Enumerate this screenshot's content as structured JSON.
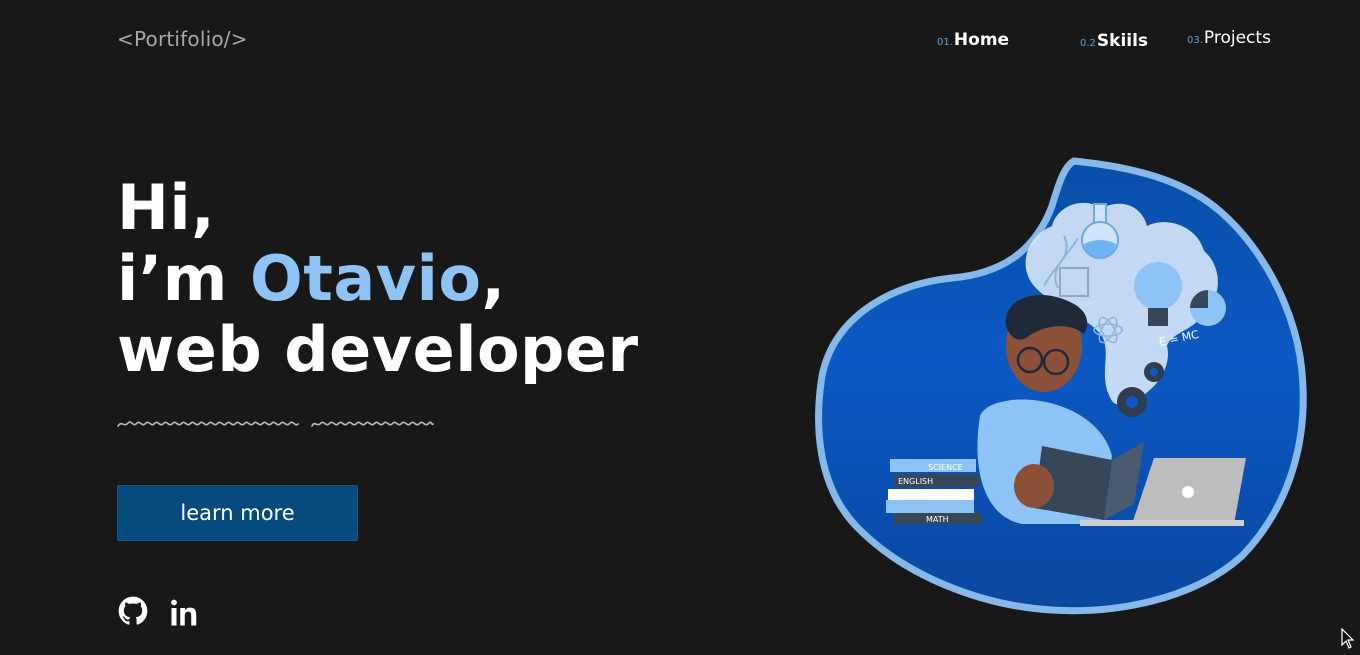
{
  "header": {
    "logo": "<Portifolio/>",
    "nav": [
      {
        "num": "01.",
        "label": "Home"
      },
      {
        "num": "0.2",
        "label": "Skiils"
      },
      {
        "num": "03.",
        "label": "Projects"
      }
    ]
  },
  "hero": {
    "line1": "Hi,",
    "line2_prefix": "i’m ",
    "name": "Otavio",
    "line2_suffix": ",",
    "line3": "web developer",
    "button_label": "learn more"
  },
  "illustration": {
    "book_labels": [
      "SCIENCE",
      "ENGLISH",
      "MATH"
    ],
    "formula": "E = MC"
  },
  "social": {
    "icons": [
      "github-icon",
      "linkedin-icon"
    ]
  },
  "colors": {
    "background": "#181818",
    "accent": "#8ec3f5",
    "button": "#064a7e",
    "nav_number": "#5c9ddf"
  }
}
